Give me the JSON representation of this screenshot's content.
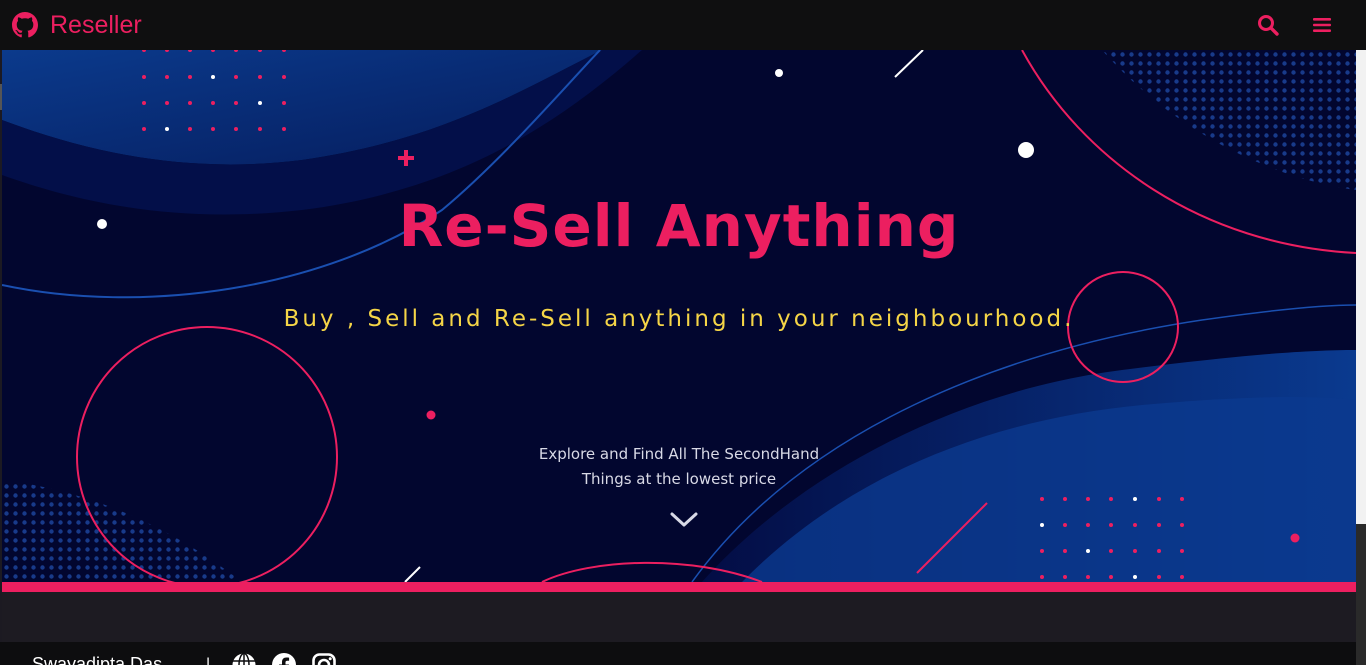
{
  "navbar": {
    "brand": "Reseller",
    "icons": {
      "brand": "github-icon",
      "search": "search-icon",
      "menu": "hamburger-menu-icon"
    }
  },
  "hero": {
    "title": "Re-Sell Anything",
    "subtitle": "Buy , Sell and Re-Sell anything in your neighbourhood.",
    "explore_line1": "Explore and Find All The SecondHand",
    "explore_line2": "Things at the lowest price",
    "scroll_icon": "chevron-down-icon"
  },
  "footer": {
    "name": "Swayadipta Das",
    "separator": "|",
    "icons": [
      "globe-icon",
      "facebook-icon",
      "instagram-icon"
    ]
  },
  "colors": {
    "accent": "#ec1f60",
    "subtitle": "#f5d547",
    "hero_bg": "#02062f",
    "navbar_bg": "#0f0f10"
  }
}
